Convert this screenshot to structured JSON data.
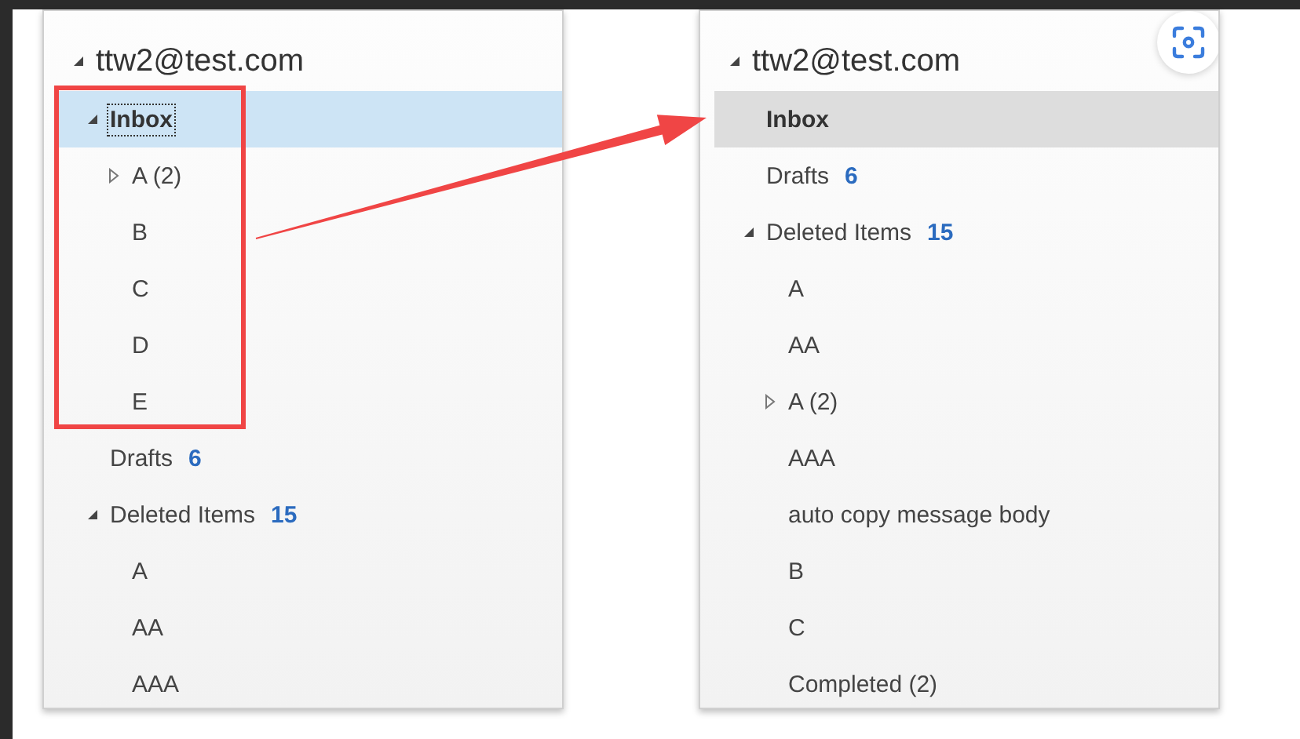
{
  "panels": [
    {
      "focused": true,
      "account": {
        "label": "ttw2@test.com",
        "expanded": true
      },
      "folders": [
        {
          "label": "Inbox",
          "bold": true,
          "selected": true,
          "expanded": true,
          "children": [
            {
              "label": "A (2)",
              "bold": false,
              "selected": false,
              "expanded": false
            },
            {
              "label": "B",
              "bold": false,
              "selected": false
            },
            {
              "label": "C",
              "bold": false,
              "selected": false
            },
            {
              "label": "D",
              "bold": false,
              "selected": false
            },
            {
              "label": "E",
              "bold": false,
              "selected": false
            }
          ]
        },
        {
          "label": "Drafts",
          "count": "6",
          "bold": false,
          "selected": false
        },
        {
          "label": "Deleted Items",
          "count": "15",
          "bold": false,
          "selected": false,
          "expanded": true,
          "children": [
            {
              "label": "A",
              "bold": false,
              "selected": false
            },
            {
              "label": "AA",
              "bold": false,
              "selected": false
            },
            {
              "label": "AAA",
              "bold": false,
              "selected": false
            }
          ]
        }
      ]
    },
    {
      "focused": false,
      "account": {
        "label": "ttw2@test.com",
        "expanded": true
      },
      "folders": [
        {
          "label": "Inbox",
          "bold": true,
          "selected": true
        },
        {
          "label": "Drafts",
          "count": "6",
          "bold": false,
          "selected": false
        },
        {
          "label": "Deleted Items",
          "count": "15",
          "bold": false,
          "selected": false,
          "expanded": true,
          "children": [
            {
              "label": "A",
              "bold": false,
              "selected": false
            },
            {
              "label": "AA",
              "bold": false,
              "selected": false
            },
            {
              "label": "A (2)",
              "bold": false,
              "selected": false,
              "expanded": false
            },
            {
              "label": "AAA",
              "bold": false,
              "selected": false
            },
            {
              "label": "auto copy message body",
              "bold": false,
              "selected": false
            },
            {
              "label": "B",
              "bold": false,
              "selected": false
            },
            {
              "label": "C",
              "bold": false,
              "selected": false
            },
            {
              "label": "Completed (2)",
              "bold": false,
              "selected": false
            }
          ]
        }
      ]
    }
  ]
}
